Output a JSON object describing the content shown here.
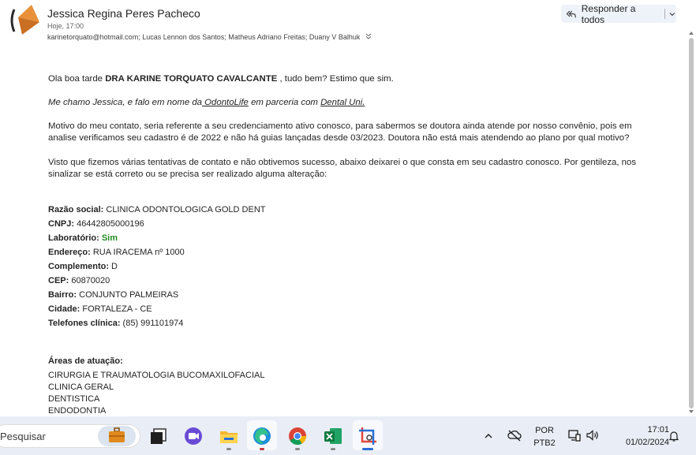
{
  "header": {
    "sender": "Jessica Regina Peres Pacheco",
    "date": "Hoje, 17:00",
    "recipients": "karinetorquato@hotmail.com; Lucas Lennon dos Santos; Matheus Adriano Freitas; Duany V Balhuk",
    "reply_all_label": "Responder a todos"
  },
  "body": {
    "greeting_pre": "Ola boa tarde ",
    "greeting_bold": "DRA   KARINE TORQUATO CAVALCANTE",
    "greeting_post": " , tudo bem? Estimo que sim.",
    "intro_pre": "Me chamo Jessica, e falo em nome da",
    "intro_link1": " OdontoLife",
    "intro_mid": " em parceria com ",
    "intro_link2": "Dental Uni.",
    "motivo_line1": "Motivo do meu contato, seria referente a seu credenciamento ativo conosco, para sabermos se doutora ainda atende por nosso convênio, pois em",
    "motivo_line2": "analise verificamos seu cadastro é de 2022 e não há guias lançadas desde 03/2023. Doutora não está mais atendendo ao plano por qual motivo?",
    "visto_line1": "Visto que fizemos várias tentativas de contato e não obtivemos sucesso, abaixo deixarei o que consta em seu cadastro conosco. Por gentileza, nos",
    "visto_line2": "sinalizar se está correto ou se precisa ser realizado alguma alteração:",
    "fields": [
      {
        "label": "Razão social:",
        "value": " CLINICA ODONTOLOGICA GOLD DENT"
      },
      {
        "label": "CNPJ:",
        "value": " 46442805000196"
      },
      {
        "label": "Laboratório:",
        "value": " Sim"
      },
      {
        "label": "Endereço:",
        "value": " RUA IRACEMA nº 1000"
      },
      {
        "label": "Complemento:",
        "value": " D"
      },
      {
        "label": "CEP:",
        "value": " 60870020"
      },
      {
        "label": "Bairro:",
        "value": " CONJUNTO PALMEIRAS"
      },
      {
        "label": "Cidade:",
        "value": " FORTALEZA - CE"
      },
      {
        "label": "Telefones clínica:",
        "value": " (85) 991101974"
      }
    ],
    "areas_title": "Áreas de atuação:",
    "areas": [
      "CIRURGIA E TRAUMATOLOGIA BUCOMAXILOFACIAL",
      "CLINICA GERAL",
      "DENTISTICA",
      "ENDODONTIA"
    ]
  },
  "taskbar": {
    "search_placeholder": "Pesquisar",
    "apps": [
      "work-briefcase-icon",
      "terminal-icon",
      "meet-icon",
      "file-explorer-icon",
      "edge-icon",
      "chrome-icon",
      "excel-icon",
      "snipping-tool-icon"
    ],
    "lang_top": "POR",
    "lang_bottom": "PTB2",
    "time": "17:01",
    "date": "01/02/2024"
  },
  "colors": {
    "accent": "#2a6fd6",
    "green_value": "#228b22",
    "reply_bg": "#eef3fa",
    "taskbar_bg": "#e9eef6"
  }
}
